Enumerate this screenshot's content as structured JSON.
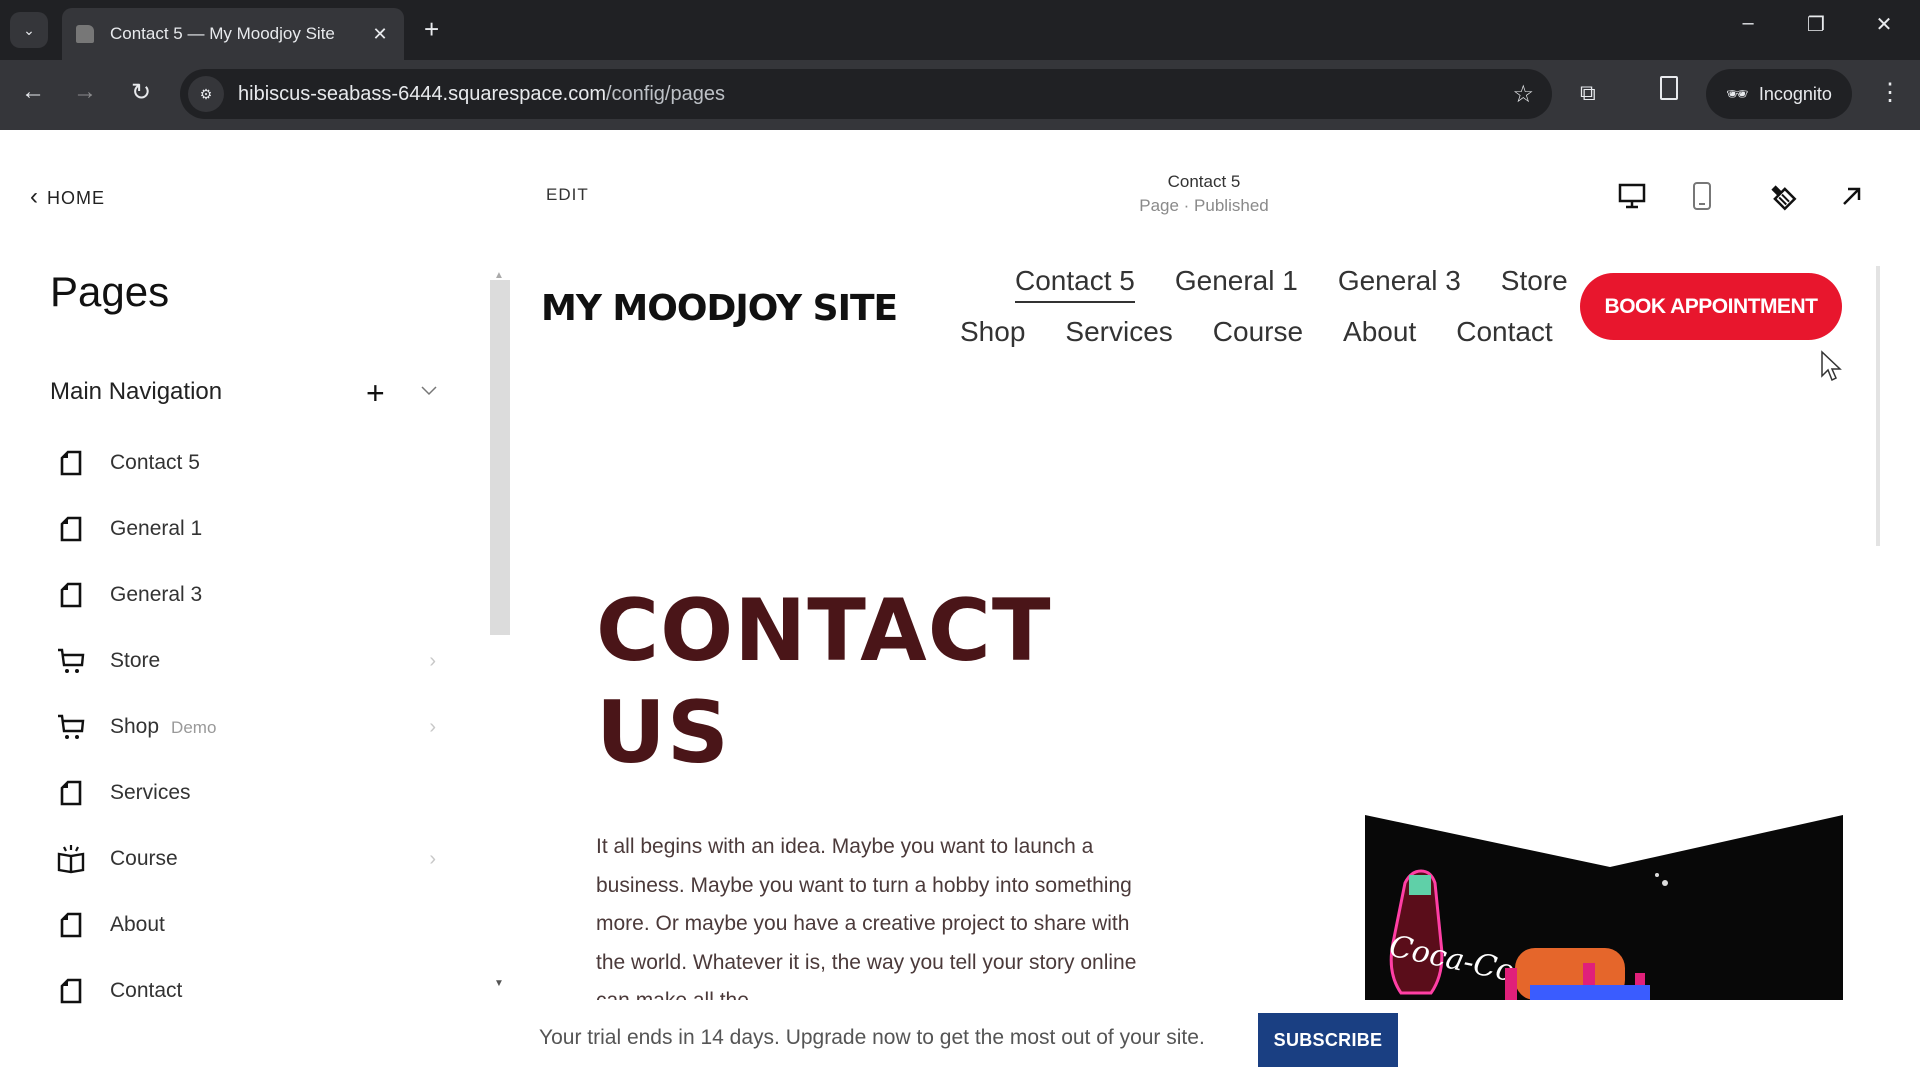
{
  "browser": {
    "tab_title": "Contact 5 — My Moodjoy Site",
    "url_host": "hibiscus-seabass-6444.squarespace.com",
    "url_path": "/config/pages",
    "profile_label": "Incognito"
  },
  "editor": {
    "home_label": "HOME",
    "edit_label": "EDIT",
    "page_name": "Contact 5",
    "page_status": "Page · Published",
    "view_icons": [
      "desktop-view-icon",
      "mobile-view-icon",
      "design-brush-icon",
      "open-external-icon"
    ]
  },
  "sidebar": {
    "title": "Pages",
    "section_title": "Main Navigation",
    "items": [
      {
        "label": "Contact 5",
        "icon": "page-icon",
        "has_children": false,
        "tag": ""
      },
      {
        "label": "General 1",
        "icon": "page-icon",
        "has_children": false,
        "tag": ""
      },
      {
        "label": "General 3",
        "icon": "page-icon",
        "has_children": false,
        "tag": ""
      },
      {
        "label": "Store",
        "icon": "cart-icon",
        "has_children": true,
        "tag": ""
      },
      {
        "label": "Shop",
        "icon": "cart-icon",
        "has_children": true,
        "tag": "Demo"
      },
      {
        "label": "Services",
        "icon": "page-icon",
        "has_children": false,
        "tag": ""
      },
      {
        "label": "Course",
        "icon": "course-book-icon",
        "has_children": true,
        "tag": ""
      },
      {
        "label": "About",
        "icon": "page-icon",
        "has_children": false,
        "tag": ""
      },
      {
        "label": "Contact",
        "icon": "page-icon",
        "has_children": false,
        "tag": ""
      }
    ]
  },
  "site": {
    "logo": "MY MOODJOY SITE",
    "nav_row1": [
      "Contact 5",
      "General 1",
      "General 3",
      "Store"
    ],
    "nav_row2": [
      "Shop",
      "Services",
      "Course",
      "About",
      "Contact"
    ],
    "active_nav": "Contact 5",
    "cta_label": "BOOK APPOINTMENT",
    "heading_line1": "CONTACT",
    "heading_line2": "US",
    "body_text": "It all begins with an idea. Maybe you want to launch a business. Maybe you want to turn a hobby into something more. Or maybe you have a creative project to share with the world. Whatever it is, the way you tell your story online can make all the",
    "image_alt": "Neon Coca-Cola sign at night",
    "colors": {
      "cta": "#e8162d",
      "heading": "#4a1518",
      "subscribe": "#1a3f82"
    }
  },
  "trial": {
    "message": "Your trial ends in 14 days. Upgrade now to get the most out of your site.",
    "button_label": "SUBSCRIBE"
  }
}
